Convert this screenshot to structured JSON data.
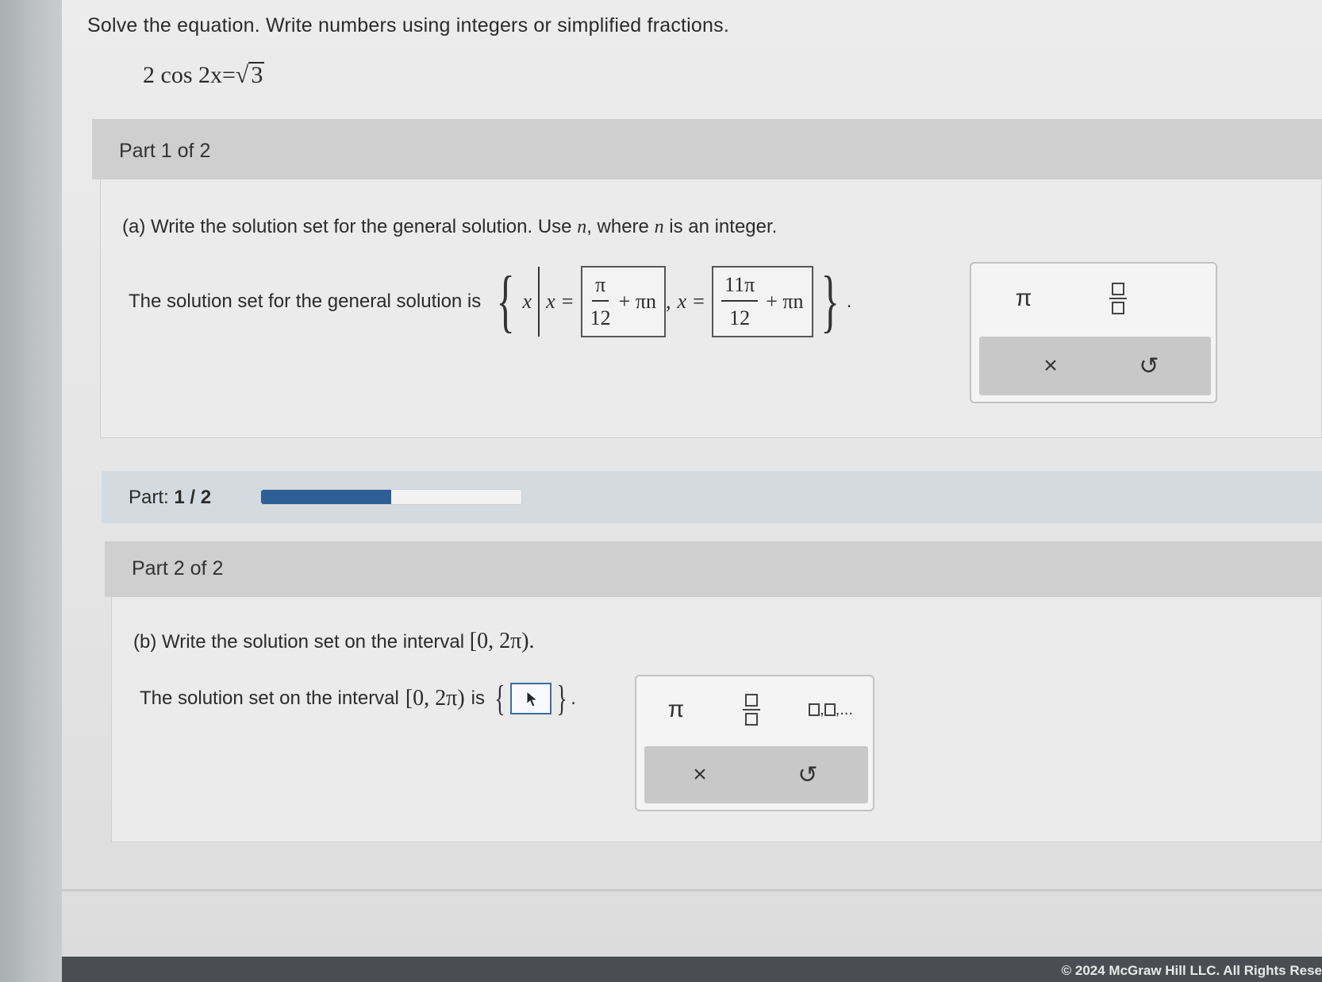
{
  "instructions": "Solve the equation. Write numbers using integers or simplified fractions.",
  "equation": {
    "lhs": "2 cos 2x",
    "equals": "=",
    "radicand": "3"
  },
  "part1": {
    "header": "Part 1 of 2",
    "question_prefix": "(a) Write the solution set for the general solution. Use ",
    "question_var1": "n",
    "question_mid": ", where ",
    "question_var2": "n",
    "question_suffix": " is an integer.",
    "answer_prefix": "The solution set for the general solution is",
    "set_var": "x",
    "x_eq_1": "x =",
    "box1_num": "π",
    "box1_den": "12",
    "box1_tail": "+ πn",
    "separator": ",",
    "x_eq_2": "x =",
    "box2_num": "11π",
    "box2_den": "12",
    "box2_tail": "+ πn",
    "period": "."
  },
  "progress": {
    "label": "Part:",
    "value": "1 / 2",
    "fraction": 0.5
  },
  "part2": {
    "header": "Part 2 of 2",
    "question_prefix": "(b) Write the solution set on the interval",
    "interval": "[0, 2π).",
    "answer_prefix": "The solution set on the interval",
    "answer_interval": "[0, 2π)",
    "answer_is": "is",
    "period": "."
  },
  "palette1": {
    "pi_label": "π",
    "clear_label": "×",
    "undo_label": "↺"
  },
  "palette2": {
    "pi_label": "π",
    "list_label": ",...",
    "clear_label": "×",
    "undo_label": "↺"
  },
  "footer": {
    "copyright": "© 2024 McGraw Hill LLC. All Rights Rese"
  }
}
